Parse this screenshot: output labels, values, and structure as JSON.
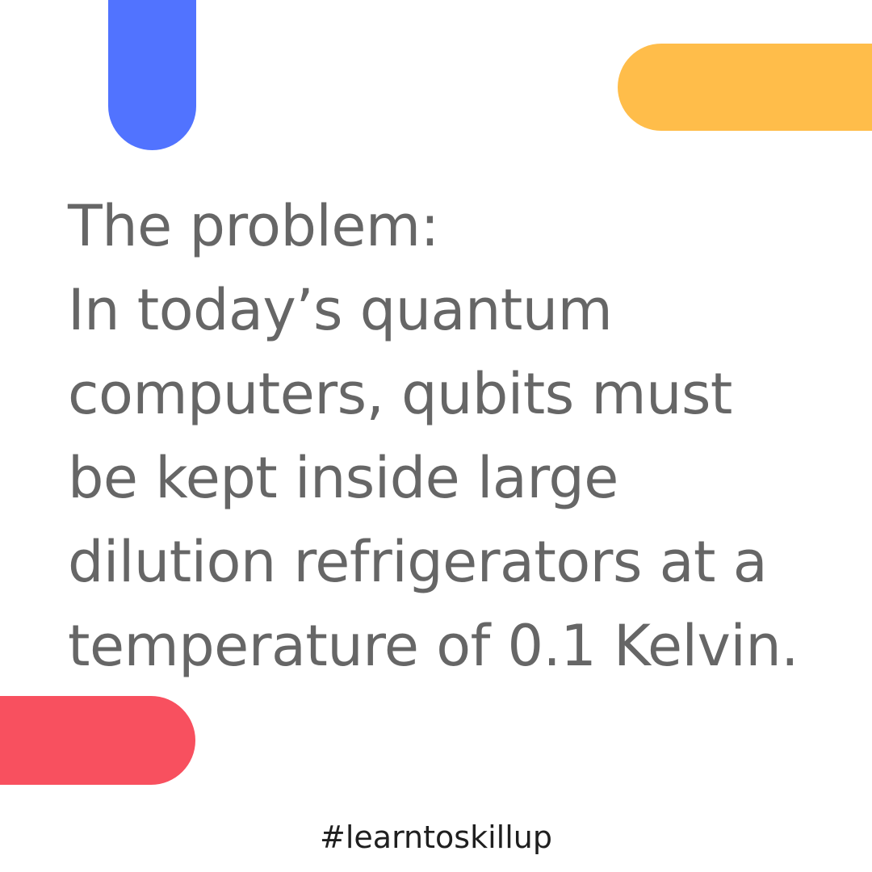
{
  "colors": {
    "background": "#ffffff",
    "blue_bar": "#5173ff",
    "yellow_bar": "#ffbd4a",
    "red_bar": "#f8505f",
    "main_text": "#666666",
    "hashtag_text": "#1f1f1f"
  },
  "content": {
    "heading": "The problem:",
    "body_lines": [
      "In today’s quantum",
      "computers, qubits must",
      "be kept inside large",
      "dilution refrigerators at a",
      "temperature of 0.1 Kelvin."
    ],
    "hashtag": "#learntoskillup"
  }
}
